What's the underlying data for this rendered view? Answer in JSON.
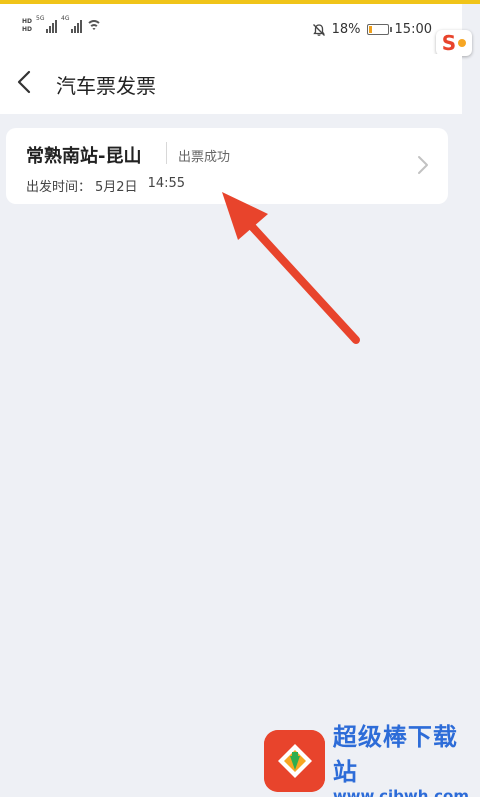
{
  "status_bar": {
    "hd_top": "HD",
    "hd_bottom": "HD",
    "network_1": "5G",
    "network_2": "4G",
    "battery_percent": "18%",
    "battery_level": 0.18,
    "time": "15:00",
    "icons": [
      "signal-icon",
      "wifi-icon",
      "bell-off-icon",
      "battery-icon"
    ]
  },
  "header": {
    "title": "汽车票发票",
    "back_icon": "chevron-left-icon"
  },
  "ticket": {
    "route": "常熟南站-昆山",
    "status": "出票成功",
    "depart_label": "出发时间：",
    "depart_date": "5月2日",
    "depart_time": "14:55"
  },
  "watermark": {
    "title": "超级棒下载站",
    "url": "www.cjbwh.com"
  },
  "colors": {
    "background": "#eef0f5",
    "card": "#ffffff",
    "arrow": "#e8442c",
    "watermark": "#2d6cd8",
    "top_border": "#f0c419"
  }
}
